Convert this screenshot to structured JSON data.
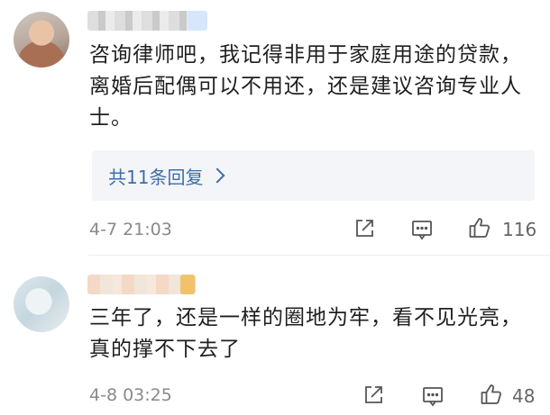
{
  "comments": [
    {
      "text": "咨询律师吧，我记得非用于家庭用途的贷款，离婚后配偶可以不用还，还是建议咨询专业人士。",
      "replies_label": "共11条回复",
      "time": "4-7 21:03",
      "likes": "116"
    },
    {
      "text": "三年了，还是一样的圈地为牢，看不见光亮，真的撑不下去了",
      "time": "4-8 03:25",
      "likes": "48"
    }
  ],
  "icons": {
    "share": "share-icon",
    "reply": "comment-icon",
    "like": "thumbs-up-icon",
    "replies_arrow": "chevron-right-icon"
  },
  "colors": {
    "link": "#3f6ea6",
    "meta": "#8a8a8a",
    "reply_box": "#f3f5f8"
  }
}
